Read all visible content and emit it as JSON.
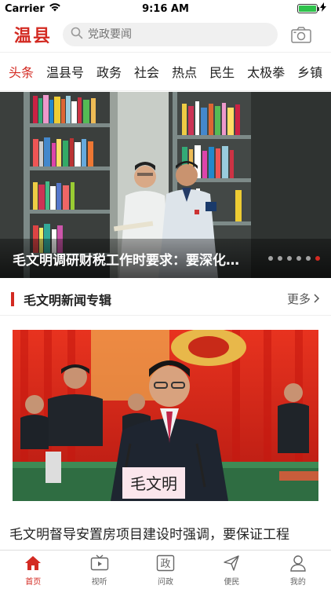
{
  "status_bar": {
    "carrier": "Carrier",
    "time": "9:16 AM",
    "battery_level": 1.0
  },
  "header": {
    "logo": "温县",
    "search_placeholder": "党政要闻"
  },
  "tabs": [
    {
      "label": "头条",
      "active": true
    },
    {
      "label": "温县号",
      "active": false
    },
    {
      "label": "政务",
      "active": false
    },
    {
      "label": "社会",
      "active": false
    },
    {
      "label": "热点",
      "active": false
    },
    {
      "label": "民生",
      "active": false
    },
    {
      "label": "太极拳",
      "active": false
    },
    {
      "label": "乡镇",
      "active": false
    }
  ],
  "banner": {
    "title": "毛文明调研财税工作时要求：要深化财税…",
    "slide_count": 6,
    "active_slide": 5
  },
  "section": {
    "title": "毛文明新闻专辑",
    "more": "更多"
  },
  "article": {
    "nameplate": "毛文明",
    "title": "毛文明督导安置房项目建设时强调，要保证工程"
  },
  "tabbar": [
    {
      "label": "首页",
      "icon": "home-icon",
      "active": true
    },
    {
      "label": "视听",
      "icon": "tv-icon",
      "active": false
    },
    {
      "label": "问政",
      "icon": "politics-icon",
      "active": false
    },
    {
      "label": "便民",
      "icon": "send-icon",
      "active": false
    },
    {
      "label": "我的",
      "icon": "user-icon",
      "active": false
    }
  ],
  "colors": {
    "accent": "#d32a22",
    "battery": "#2ec24b"
  }
}
